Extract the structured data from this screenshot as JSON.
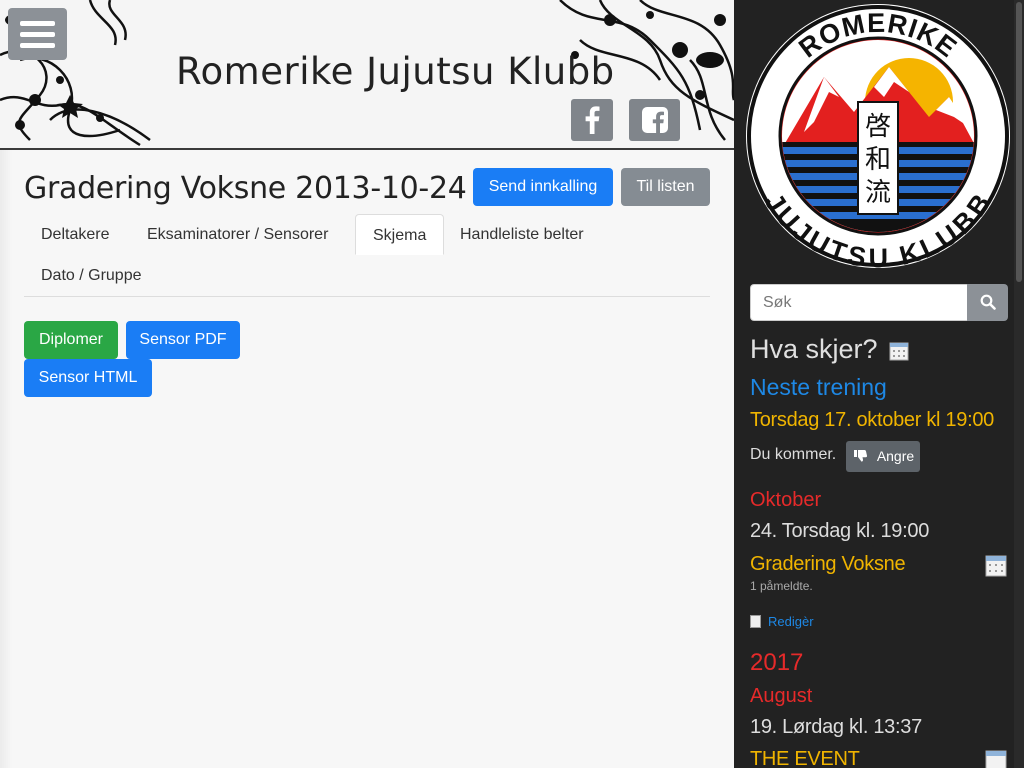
{
  "header": {
    "site_title": "Romerike Jujutsu Klubb",
    "menu_icon": "hamburger-menu-icon",
    "social": [
      {
        "icon": "facebook-icon"
      },
      {
        "icon": "facebook-square-icon"
      }
    ]
  },
  "main": {
    "page_title": "Gradering Voksne 2013-10-24",
    "send_button": "Send innkalling",
    "back_button": "Til listen",
    "tabs": [
      {
        "label": "Deltakere",
        "active": false
      },
      {
        "label": "Eksaminatorer / Sensorer",
        "active": false
      },
      {
        "label": "Skjema",
        "active": true
      },
      {
        "label": "Handleliste belter",
        "active": false
      },
      {
        "label": "Dato / Gruppe",
        "active": false
      }
    ],
    "actions": {
      "diplomer": "Diplomer",
      "sensor_pdf": "Sensor PDF",
      "sensor_html": "Sensor HTML"
    }
  },
  "sidebar": {
    "logo": {
      "top_text": "ROMERIKE",
      "bottom_text": "JUJUTSU KLUBB",
      "kanji": [
        "啓",
        "和",
        "流"
      ]
    },
    "search": {
      "placeholder": "Søk",
      "icon": "search-icon"
    },
    "heading": "Hva skjer?",
    "next_training_label": "Neste trening",
    "next_training_time": "Torsdag 17. oktober kl 19:00",
    "attending_text": "Du kommer.",
    "cancel_button": "Angre",
    "events": {
      "month1": "Oktober",
      "day1": "24. Torsdag kl. 19:00",
      "event1_title": "Gradering Voksne",
      "event1_registered": "1 påmeldte.",
      "edit_link": "Redigèr",
      "year2": "2017",
      "month2": "August",
      "day2": "19. Lørdag kl. 13:37",
      "event2_title": "THE EVENT"
    },
    "colors": {
      "background": "#222222",
      "blue": "#1e88e5",
      "yellow": "#f0b400",
      "red": "#e62a2a"
    }
  }
}
